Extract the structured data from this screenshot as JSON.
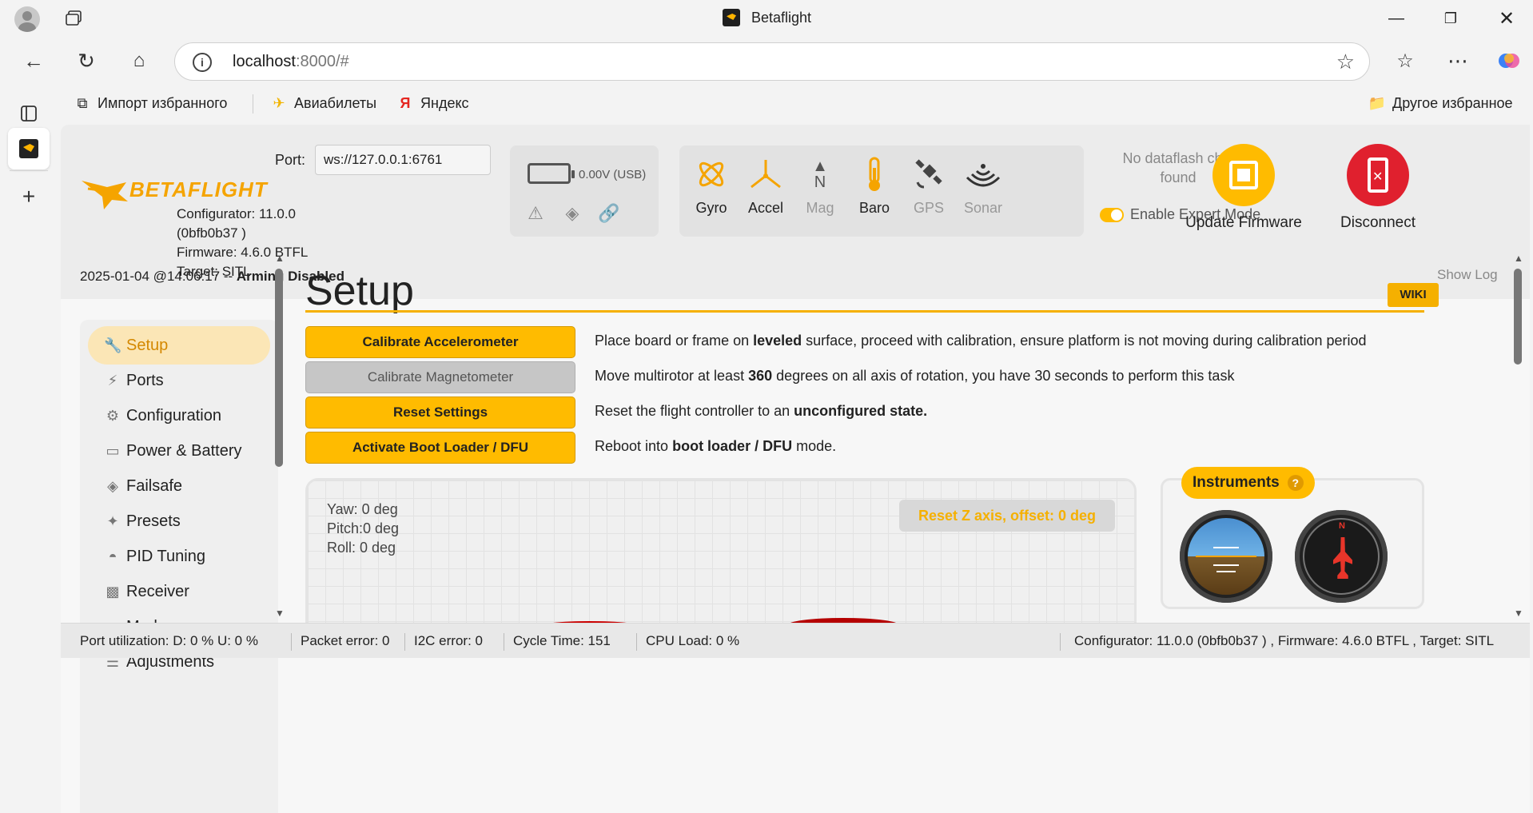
{
  "browser": {
    "window_title": "Betaflight",
    "url_host": "localhost",
    "url_rest": ":8000/#",
    "favorites": [
      {
        "label": "Импорт избранного",
        "icon": "import-icon"
      },
      {
        "label": "Авиабилеты",
        "icon": "airplane-icon"
      },
      {
        "label": "Яндекс",
        "icon": "yandex-icon"
      }
    ],
    "other_favorites": "Другое избранное"
  },
  "header": {
    "logo_text": "BETAFLIGHT",
    "port_label": "Port:",
    "port_value": "ws://127.0.0.1:6761",
    "configurator_line1": "Configurator: 11.0.0",
    "configurator_line2": "(0bfb0b37 )",
    "firmware_line": "Firmware: 4.6.0 BTFL",
    "target_line": "Target: SITL",
    "status_date": "2025-01-04 @14:06:17 --",
    "status_state": "Arming Disabled",
    "battery_text": "0.00V (USB)",
    "sensors": [
      {
        "label": "Gyro",
        "state": "on"
      },
      {
        "label": "Accel",
        "state": "on"
      },
      {
        "label": "Mag",
        "state": "off"
      },
      {
        "label": "Baro",
        "state": "on"
      },
      {
        "label": "GPS",
        "state": "off"
      },
      {
        "label": "Sonar",
        "state": "off"
      }
    ],
    "dataflash": "No dataflash chip found",
    "expert_mode_label": "Enable Expert Mode",
    "update_firmware_label": "Update Firmware",
    "disconnect_label": "Disconnect",
    "show_log": "Show Log",
    "colors": {
      "accent": "#ffbb00",
      "update": "#ffbb00",
      "disconnect": "#e0202e"
    }
  },
  "sidebar": {
    "items": [
      {
        "label": "Setup",
        "icon": "wrench-icon",
        "active": true
      },
      {
        "label": "Ports",
        "icon": "plug-icon"
      },
      {
        "label": "Configuration",
        "icon": "gear-icon"
      },
      {
        "label": "Power & Battery",
        "icon": "battery-icon"
      },
      {
        "label": "Failsafe",
        "icon": "parachute-icon"
      },
      {
        "label": "Presets",
        "icon": "magic-wand-icon"
      },
      {
        "label": "PID Tuning",
        "icon": "hierarchy-icon"
      },
      {
        "label": "Receiver",
        "icon": "robot-icon"
      },
      {
        "label": "Modes",
        "icon": "toggles-icon"
      },
      {
        "label": "Adjustments",
        "icon": "sliders-icon"
      }
    ]
  },
  "main": {
    "title": "Setup",
    "wiki": "WIKI",
    "actions": [
      {
        "button": "Calibrate Accelerometer",
        "enabled": true,
        "desc_pre": "Place board or frame on ",
        "desc_bold": "leveled",
        "desc_post": " surface, proceed with calibration, ensure platform is not moving during calibration period"
      },
      {
        "button": "Calibrate Magnetometer",
        "enabled": false,
        "desc_pre": "Move multirotor at least ",
        "desc_bold": "360",
        "desc_post": " degrees on all axis of rotation, you have 30 seconds to perform this task"
      },
      {
        "button": "Reset Settings",
        "enabled": true,
        "desc_pre": "Reset the flight controller to an ",
        "desc_bold": "unconfigured state.",
        "desc_post": ""
      },
      {
        "button": "Activate Boot Loader / DFU",
        "enabled": true,
        "desc_pre": "Reboot into ",
        "desc_bold": "boot loader / DFU",
        "desc_post": " mode."
      }
    ],
    "yaw": "Yaw:  0 deg",
    "pitch": "Pitch:0 deg",
    "roll": "Roll:  0 deg",
    "reset_z": "Reset Z axis, offset: 0 deg",
    "instruments_label": "Instruments"
  },
  "footer": {
    "port_util": "Port utilization: D: 0 % U: 0 %",
    "packet_error": "Packet error: 0",
    "i2c_error": "I2C error: 0",
    "cycle_time": "Cycle Time: 151",
    "cpu_load": "CPU Load: 0 %",
    "version": "Configurator: 11.0.0 (0bfb0b37 ) , Firmware: 4.6.0 BTFL , Target: SITL"
  }
}
